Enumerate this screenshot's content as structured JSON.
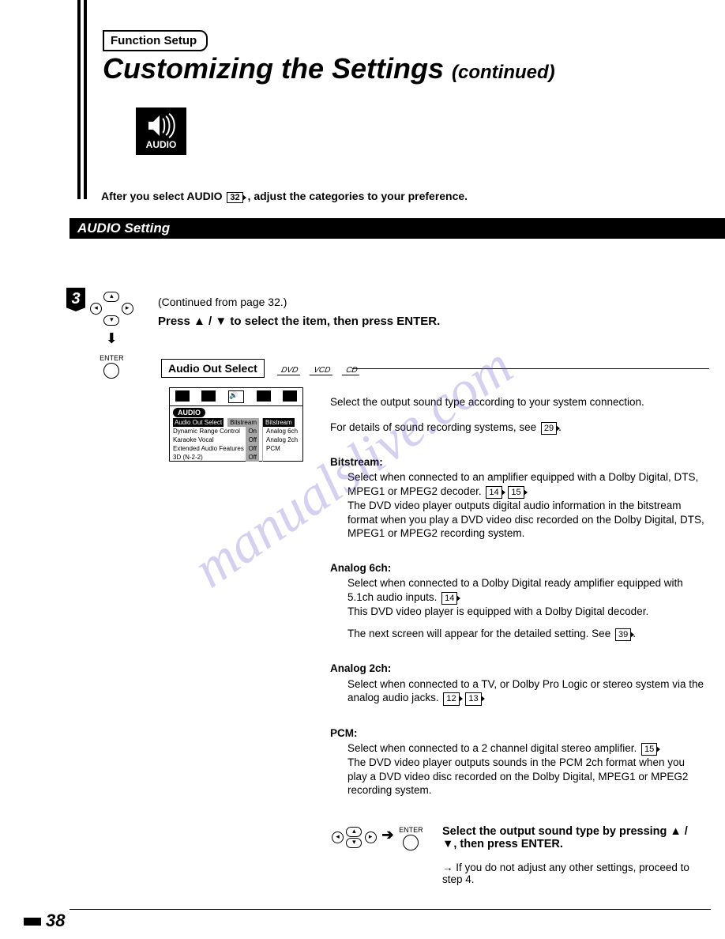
{
  "tab": "Function Setup",
  "title_main": "Customizing the Settings",
  "title_cont": "(continued)",
  "audio_icon_label": "AUDIO",
  "intro_before": "After you select AUDIO ",
  "intro_ref": "32",
  "intro_after": ", adjust the categories to your preference.",
  "bar": "AUDIO Setting",
  "step": "3",
  "enter_label": "ENTER",
  "cont_from": "(Continued from page 32.)",
  "press_line": "Press ▲ / ▼ to select the item, then press ENTER.",
  "sec_title": "Audio Out Select",
  "fmt": [
    "DVD",
    "VCD",
    "CD"
  ],
  "menu": {
    "label": "AUDIO",
    "items": [
      {
        "k": "Audio Out Select",
        "v": "Bitstream",
        "sel": true
      },
      {
        "k": "Dynamic Range Control",
        "v": "On"
      },
      {
        "k": "Karaoke Vocal",
        "v": "Off"
      },
      {
        "k": "Extended Audio Features",
        "v": "Off"
      },
      {
        "k": "3D (N-2-2)",
        "v": "Off"
      }
    ],
    "opts": [
      "Bitstream",
      "Analog 6ch",
      "Analog 2ch",
      "PCM"
    ]
  },
  "p1": "Select the output sound type according to your system connection.",
  "p2a": "For details of sound recording systems, see ",
  "p2ref": "29",
  "p2b": ".",
  "bitstream": {
    "h": "Bitstream:",
    "t1": "Select when connected to an amplifier equipped with a Dolby Digital, DTS, MPEG1 or MPEG2 decoder. ",
    "r1": "14",
    "r2": "15",
    "t2": "The DVD video player outputs digital audio information in the bitstream format when you play a DVD video disc recorded on the Dolby Digital, DTS, MPEG1 or MPEG2 recording system."
  },
  "a6": {
    "h": "Analog 6ch:",
    "t1": "Select when connected to a Dolby Digital ready amplifier equipped with 5.1ch audio inputs. ",
    "r1": "14",
    "t2": "This DVD video player is equipped with a Dolby Digital decoder.",
    "t3a": "The next screen will appear for the detailed setting. See ",
    "r3": "39",
    "t3b": "."
  },
  "a2": {
    "h": "Analog 2ch:",
    "t1": "Select when connected to a TV, or Dolby Pro Logic or stereo system via the analog audio jacks. ",
    "r1": "12",
    "r2": "13"
  },
  "pcm": {
    "h": "PCM:",
    "t1": "Select when connected to a 2 channel digital stereo amplifier. ",
    "r1": "15",
    "t2": "The DVD video player outputs sounds in the PCM 2ch format when you play a DVD video disc recorded on the Dolby Digital, MPEG1 or MPEG2 recording system."
  },
  "instr": "Select the output sound type by pressing ▲ / ▼,  then press ENTER.",
  "instr_sub": "→ If you do not adjust any other settings, proceed to step 4.",
  "page_num": "38",
  "watermark": "manualslive.com"
}
